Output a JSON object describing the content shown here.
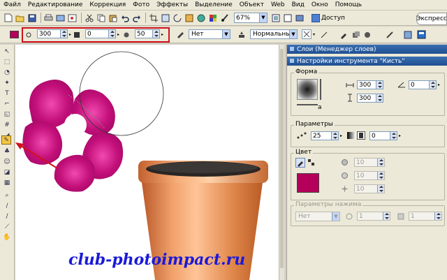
{
  "menu": [
    "Файл",
    "Редактирование",
    "Коррекция",
    "Фото",
    "Эффекты",
    "Выделение",
    "Объект",
    "Web",
    "Вид",
    "Окно",
    "Помощь"
  ],
  "toolbar": {
    "zoom_value": "67%",
    "access_label": "Доступ",
    "express_label": "Экспресс"
  },
  "attributes": {
    "brush_color": "#b4005a",
    "size_value": "300",
    "transparency_value": "0",
    "soft_edge_value": "50",
    "preset_value": "Нет",
    "blend_mode_value": "Нормальный"
  },
  "panel": {
    "layers_title": "Слои (Менеджер слоев)",
    "tool_settings_title": "Настройки инструмента \"Кисть\"",
    "shape": {
      "title": "Форма",
      "a_label": "a",
      "width_value": "300",
      "angle_value": "0",
      "height_value": "300"
    },
    "parameters": {
      "title": "Параметры",
      "spacing_value": "25",
      "fade_value": "0"
    },
    "color": {
      "title": "Цвет",
      "swatch": "#b4005a",
      "value1": "10",
      "value2": "10",
      "value3": "10"
    },
    "pressure": {
      "title": "Параметры нажима",
      "preset_value": "Нет",
      "value1": "1",
      "value2": "1"
    }
  },
  "canvas": {
    "watermark": "club-photoimpact.ru",
    "flower_color": "#c4107a",
    "pot_color": "#e0874a"
  },
  "colors": {
    "foreground": "#b4005a",
    "background": "#ffffff",
    "highlight_box": "#d0101a",
    "arrow": "#d0101a"
  }
}
